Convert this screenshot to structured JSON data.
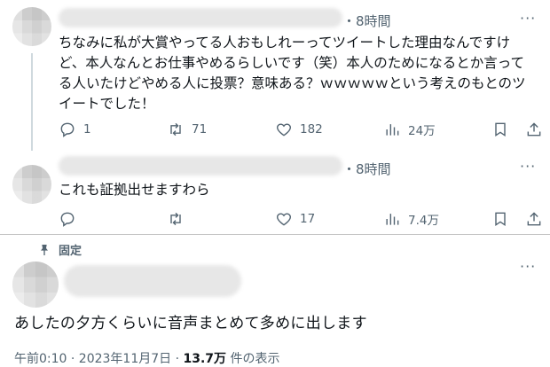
{
  "tweets": [
    {
      "time": "・8時間",
      "body": [
        "ちなみに私が大賞やってる人おもしれーってツイートした理由なんですけ",
        "ど、本人なんとお仕事やめるらしいです（笑）本人のためになるとか言って",
        "る人いたけどやめる人に投票？意味ある？ｗｗｗｗｗという考えのもとのツ",
        "イートでした！"
      ],
      "replies": "1",
      "retweets": "71",
      "likes": "182",
      "views": "24万"
    },
    {
      "time": "・8時間",
      "body": [
        "これも証拠出せますわら"
      ],
      "replies": "",
      "retweets": "",
      "likes": "17",
      "views": "7.4万"
    }
  ],
  "pinned": {
    "label": "固定",
    "body": "あしたの夕方くらいに音声まとめて多めに出します",
    "timestamp": "午前0:10 · 2023年11月7日 · ",
    "views_count": "13.7万",
    "views_label": " 件の表示"
  },
  "more_glyph": "···",
  "icons": [
    "reply-icon",
    "retweet-icon",
    "like-icon",
    "views-icon",
    "bookmark-icon",
    "share-icon",
    "pin-icon"
  ]
}
